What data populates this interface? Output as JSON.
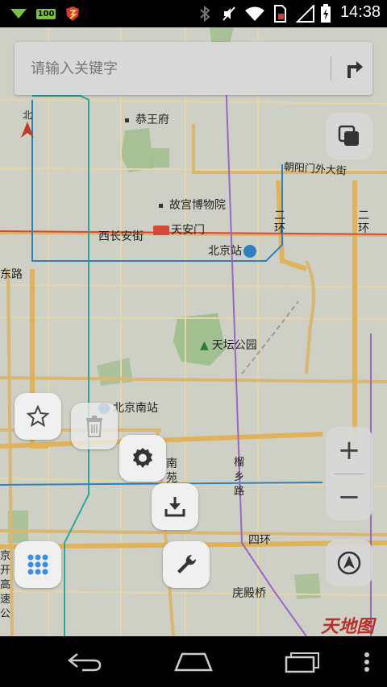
{
  "status_bar": {
    "time": "14:38",
    "notification_badge": "100",
    "icons": [
      "wifi-tray-icon",
      "notification-badge-icon",
      "app-shield-icon",
      "bluetooth-icon",
      "mute-icon",
      "wifi-icon",
      "sim-icon",
      "signal-icon",
      "battery-icon"
    ]
  },
  "search": {
    "placeholder": "请输入关键字"
  },
  "map": {
    "labels": {
      "gongwangfu": "恭王府",
      "gugong": "故宫博物院",
      "tiananmen": "天安门",
      "xichanganjie": "西长安街",
      "beijingzhan": "北京站",
      "tiantan": "天坛公园",
      "beijingnanzhan": "北京南站",
      "chaoyangmenwai": "朝阳门外大街",
      "erhuan_a": "二环",
      "erhuan_b": "二环",
      "dong_lu": "东路",
      "north": "北",
      "nanyuan": "南苑",
      "liuxiang": "榴乡路",
      "sihuan": "四环",
      "maodianqiao": "庑殿桥",
      "left_edge": "京开高速公"
    },
    "colors": {
      "background": "#cfd0c5",
      "road": "#d9b672",
      "ring_road": "#e0b25a",
      "metro_blue": "#2f7fbd",
      "metro_teal": "#2aa899",
      "metro_purple": "#9a66c8",
      "metro_red": "#d44a3a",
      "park": "#9cbc8a"
    }
  },
  "controls": {
    "zoom_in": "+",
    "zoom_out": "−",
    "watermark": "天地图"
  },
  "fab_menu": {
    "items": [
      "star-icon",
      "trash-icon",
      "gear-icon",
      "download-icon",
      "wrench-icon",
      "grid-icon"
    ]
  }
}
